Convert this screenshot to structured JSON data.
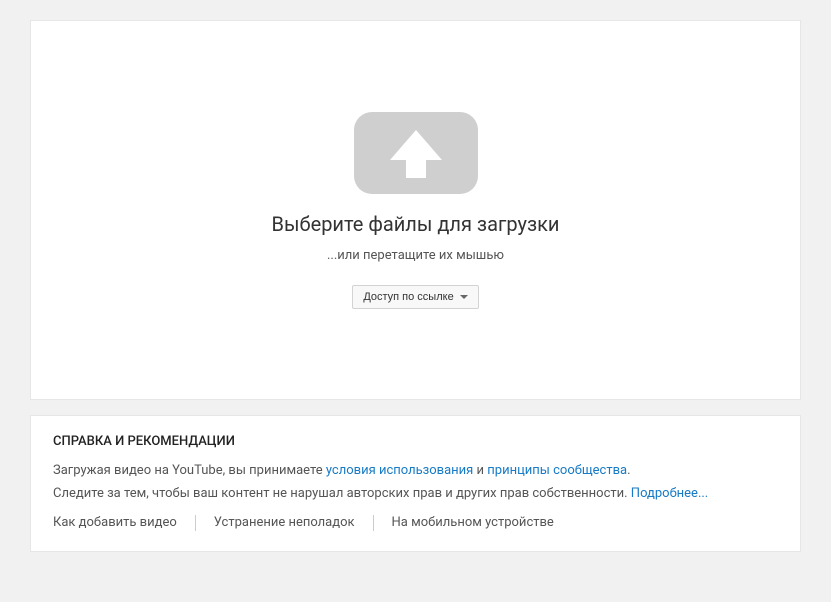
{
  "upload": {
    "title": "Выберите файлы для загрузки",
    "subtitle": "...или перетащите их мышью",
    "privacy_selected": "Доступ по ссылке"
  },
  "help": {
    "title": "СПРАВКА И РЕКОМЕНДАЦИИ",
    "line1_pre": "Загружая видео на YouTube, вы принимаете ",
    "terms": "условия использования",
    "line1_mid": " и ",
    "guidelines": "принципы сообщества",
    "line1_end": ".",
    "line2": "Следите за тем, чтобы ваш контент не нарушал авторских прав и других прав собственности. ",
    "learn_more": "Подробнее...",
    "links": {
      "how_to": "Как добавить видео",
      "troubleshoot": "Устранение неполадок",
      "mobile": "На мобильном устройстве"
    }
  },
  "colors": {
    "link": "#167ac6"
  }
}
